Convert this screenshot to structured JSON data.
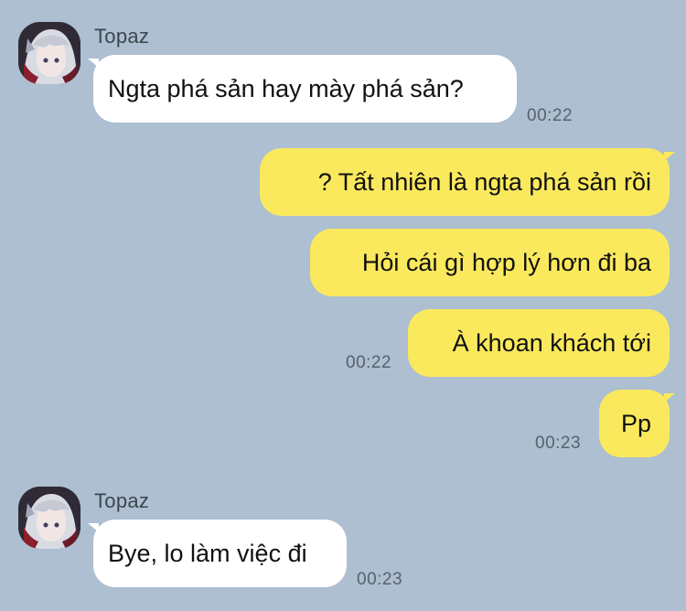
{
  "chat": {
    "messages": [
      {
        "sender": "Topaz",
        "direction": "incoming",
        "text": "Ngta phá sản hay mày phá sản?",
        "time": "00:22"
      },
      {
        "direction": "outgoing",
        "text": "? Tất nhiên là ngta phá sản rồi"
      },
      {
        "direction": "outgoing",
        "text": "Hỏi cái gì hợp lý hơn đi ba"
      },
      {
        "direction": "outgoing",
        "text": "À khoan khách tới",
        "time": "00:22"
      },
      {
        "direction": "outgoing",
        "text": "Pp",
        "time": "00:23"
      },
      {
        "sender": "Topaz",
        "direction": "incoming",
        "text": "Bye, lo làm việc đi",
        "time": "00:23"
      }
    ]
  },
  "colors": {
    "background": "#adbfd0",
    "incoming_bubble": "#ffffff",
    "outgoing_bubble": "#fae95d"
  },
  "icons": {
    "avatar": "anime-character-avatar"
  }
}
